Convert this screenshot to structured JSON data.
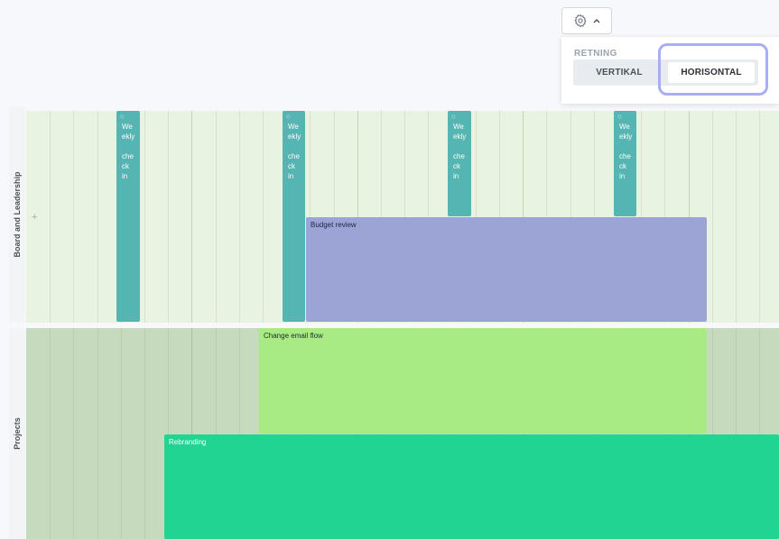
{
  "settings": {
    "button_icon": "gear-icon",
    "chevron_icon": "chevron-up-icon",
    "direction_label": "RETNING",
    "options": [
      {
        "label": "VERTIKAL",
        "selected": false
      },
      {
        "label": "HORISONTAL",
        "selected": true
      }
    ]
  },
  "rows": [
    {
      "label": "Board and Leadership"
    },
    {
      "label": "Projects"
    }
  ],
  "events": {
    "weekly_checkin": "We\nekly\n\nche\nck\nin",
    "budget_review": "Budget review",
    "change_email_flow": "Change email flow",
    "rebranding": "Rebranding"
  },
  "colors": {
    "weekly": "#54b5b2",
    "budget": "#9ca4d6",
    "email": "#a8ea84",
    "rebranding": "#21d492",
    "focus_ring": "#a9aef3"
  }
}
